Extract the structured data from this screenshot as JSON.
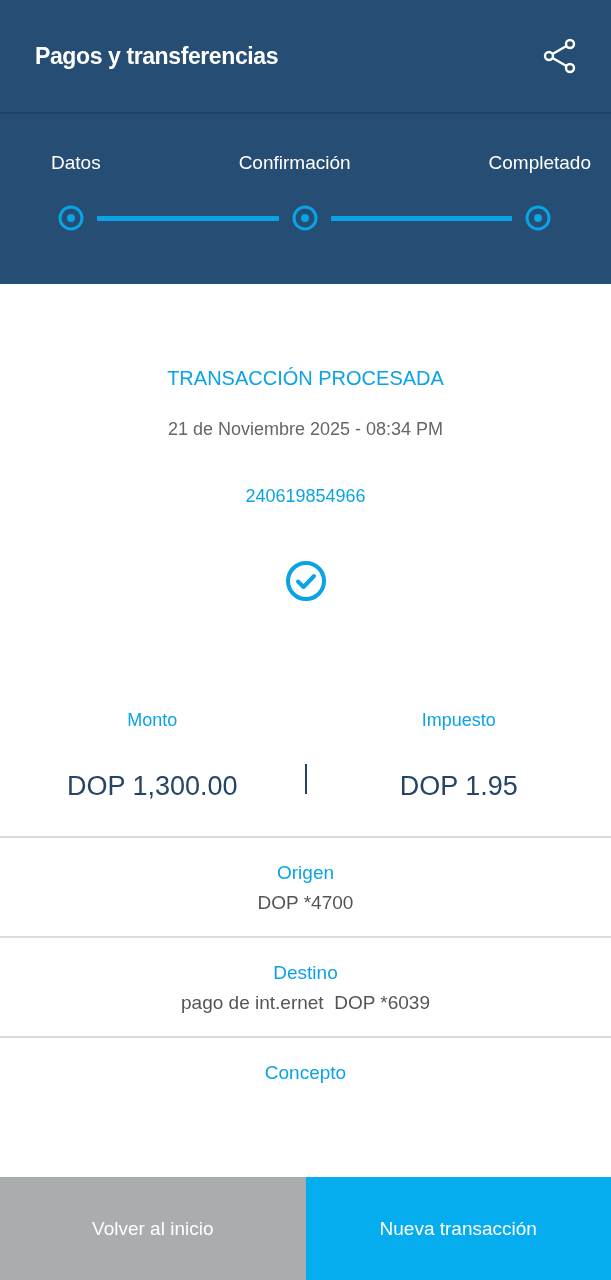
{
  "header": {
    "title": "Pagos y transferencias"
  },
  "steps": [
    {
      "label": "Datos",
      "completed": true
    },
    {
      "label": "Confirmación",
      "completed": true
    },
    {
      "label": "Completado",
      "completed": true
    }
  ],
  "result": {
    "status": "TRANSACCIÓN PROCESADA",
    "date": "21 de Noviembre 2025 - 08:34 PM",
    "reference": "240619854966",
    "success": true
  },
  "amounts": [
    {
      "label": "Monto",
      "value": "DOP 1,300.00"
    },
    {
      "label": "Impuesto",
      "value": "DOP 1.95"
    }
  ],
  "details": [
    {
      "label": "Origen",
      "value": "DOP *4700"
    },
    {
      "label": "Destino",
      "value": "pago de int.ernet  DOP *6039"
    },
    {
      "label": "Concepto"
    }
  ],
  "buttons": [
    {
      "label": "Volver al inicio",
      "kind": "secondary"
    },
    {
      "label": "Nueva transacción",
      "kind": "primary"
    }
  ]
}
